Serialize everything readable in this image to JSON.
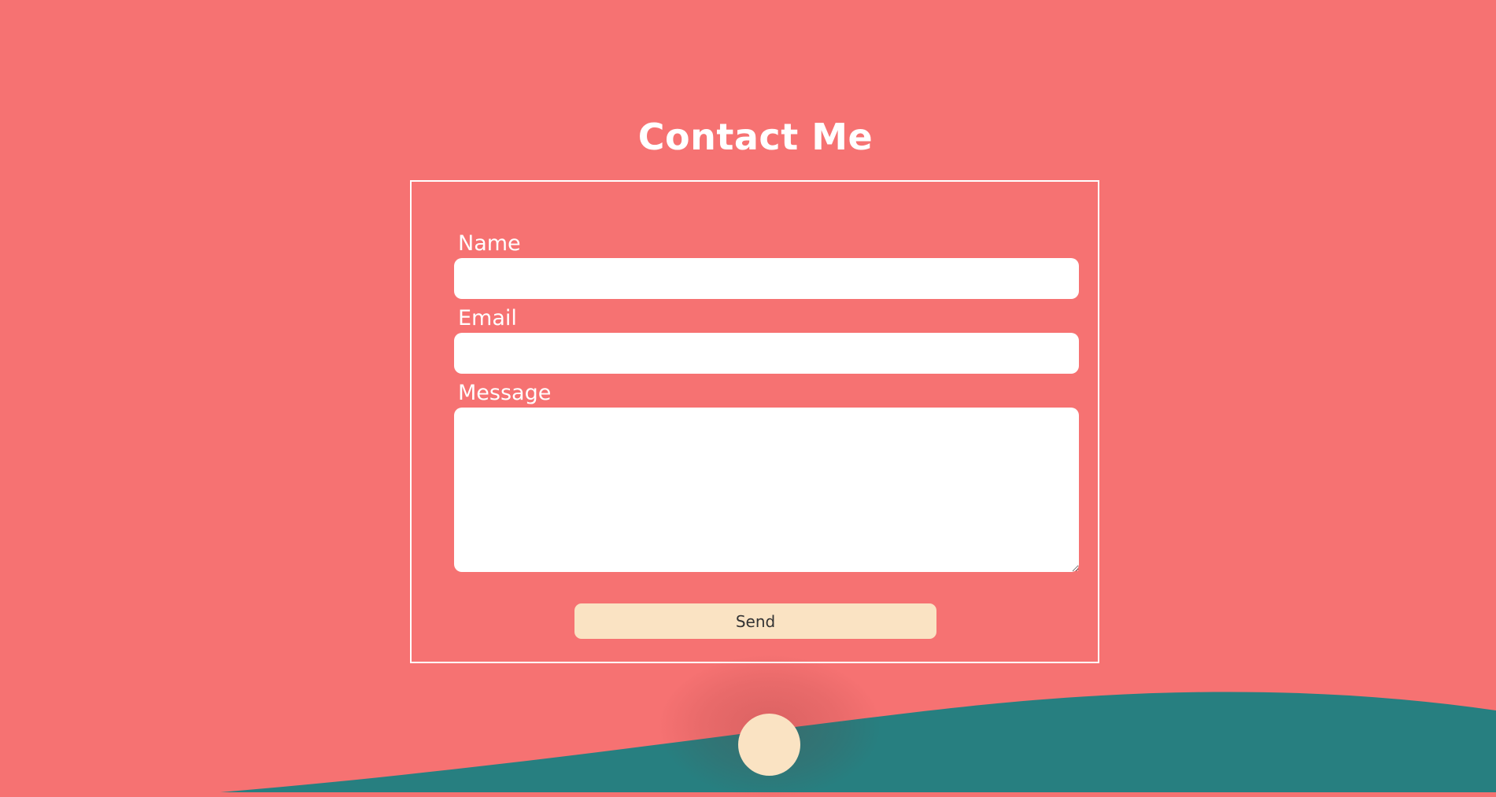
{
  "page": {
    "title": "Contact Me"
  },
  "form": {
    "name_label": "Name",
    "name_value": "",
    "email_label": "Email",
    "email_value": "",
    "message_label": "Message",
    "message_value": "",
    "send_label": "Send"
  },
  "colors": {
    "background": "#f67272",
    "wave": "#277f80",
    "accent": "#fae3c3",
    "input": "#ffffff",
    "text": "#ffffff"
  }
}
